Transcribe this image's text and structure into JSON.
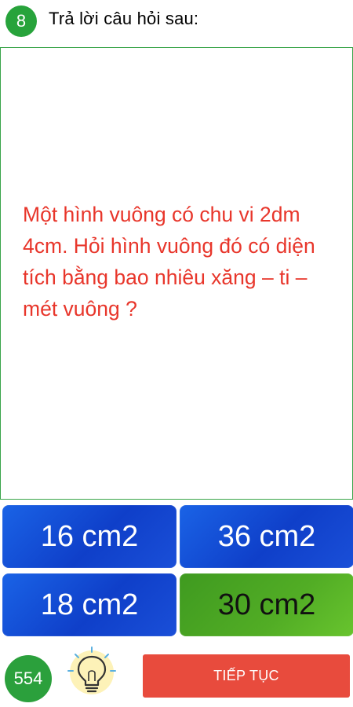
{
  "header": {
    "question_number": "8",
    "title": "Trả lời câu hỏi sau:"
  },
  "question": {
    "text": "Một hình vuông có chu vi 2dm 4cm. Hỏi hình vuông đó có diện tích bằng bao nhiêu xăng – ti – mét vuông ?",
    "color": "#e8362b"
  },
  "answers": [
    {
      "label": "16 cm2",
      "color": "#1446d6"
    },
    {
      "label": "36 cm2",
      "color": "#1446d6"
    },
    {
      "label": "18 cm2",
      "color": "#1446d6"
    },
    {
      "label": "30 cm2",
      "color": "#52ad25"
    }
  ],
  "footer": {
    "coins": "554",
    "hint_icon": "lightbulb-icon",
    "continue_label": "TIẾP TỤC"
  },
  "colors": {
    "accent_green": "#27a33b",
    "continue_red": "#e84b3d"
  }
}
